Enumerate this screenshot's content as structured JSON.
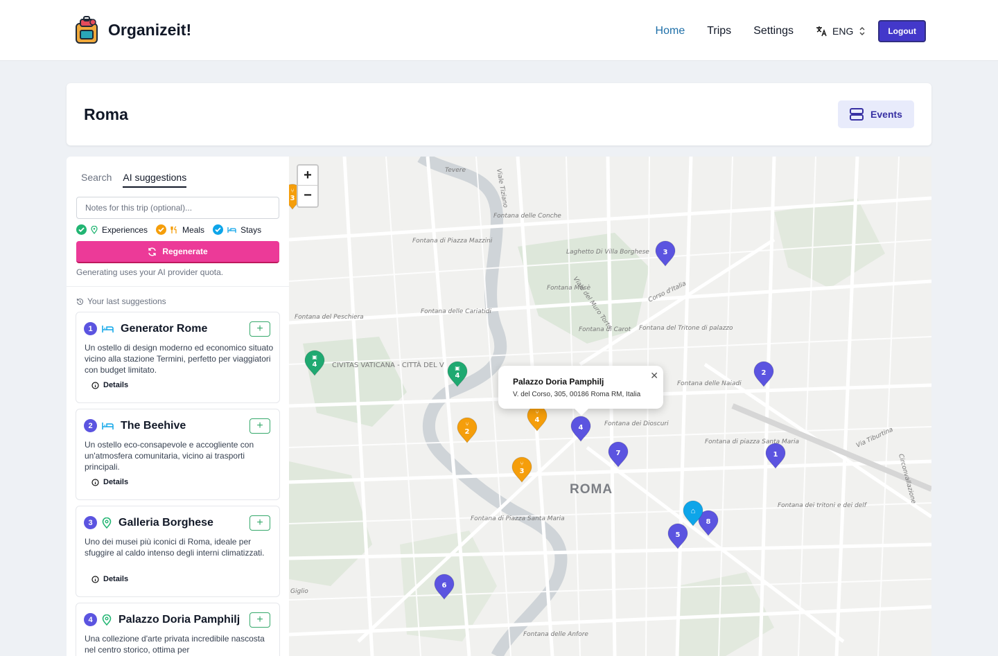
{
  "header": {
    "brand": "Organizeit!",
    "nav": [
      "Home",
      "Trips",
      "Settings"
    ],
    "language": "ENG",
    "logout": "Logout"
  },
  "trip": {
    "title": "Roma",
    "events_button": "Events"
  },
  "sidebar": {
    "tabs": [
      "Search",
      "AI suggestions"
    ],
    "active_tab": "AI suggestions",
    "notes_placeholder": "Notes for this trip (optional)...",
    "filters": [
      {
        "label": "Experiences",
        "checked": true,
        "color": "#22b573"
      },
      {
        "label": "Meals",
        "checked": true,
        "color": "#f59e0b"
      },
      {
        "label": "Stays",
        "checked": true,
        "color": "#0ea5e9"
      }
    ],
    "regenerate": "Regenerate",
    "quota_note": "Generating uses your AI provider quota.",
    "last_suggestions": "Your last suggestions",
    "details_label": "Details",
    "suggestions": [
      {
        "num": "1",
        "type": "stay",
        "title": "Generator Rome",
        "desc": "Un ostello di design moderno ed economico situato vicino alla stazione Termini, perfetto per viaggiatori con budget limitato."
      },
      {
        "num": "2",
        "type": "stay",
        "title": "The Beehive",
        "desc": "Un ostello eco-consapevole e accogliente con un'atmosfera comunitaria, vicino ai trasporti principali."
      },
      {
        "num": "3",
        "type": "experience",
        "title": "Galleria Borghese",
        "desc": "Uno dei musei più iconici di Roma, ideale per sfuggire al caldo intenso degli interni climatizzati."
      },
      {
        "num": "4",
        "type": "experience",
        "title": "Palazzo Doria Pamphilj",
        "desc": "Una collezione d'arte privata incredibile nascosta nel centro storico, ottima per"
      }
    ]
  },
  "map": {
    "city_label": "ROMA",
    "popup": {
      "title": "Palazzo Doria Pamphilj",
      "address": "V. del Corso, 305, 00186 Roma RM, Italia"
    },
    "labels": [
      {
        "text": "Tevere"
      },
      {
        "text": "Viale Tiziano"
      },
      {
        "text": "Fontana delle Conche"
      },
      {
        "text": "Fontana di Piazza Mazzini"
      },
      {
        "text": "Laghetto Di Villa Borghese"
      },
      {
        "text": "Fontana Mosè"
      },
      {
        "text": "Viale del Muro Torto"
      },
      {
        "text": "Corso d'Italia"
      },
      {
        "text": "Fontana del Peschiera"
      },
      {
        "text": "Fontana delle Cariatidi"
      },
      {
        "text": "Fontana di Carot"
      },
      {
        "text": "Fontana del Tritone di palazzo Margherita"
      },
      {
        "text": "CIVITAS VATICANA - CITTÀ DEL VATICANO"
      },
      {
        "text": "Fontana delle Naiadi"
      },
      {
        "text": "Fontana dei Dioscuri"
      },
      {
        "text": "Fontana di piazza Santa Maria Maggiore"
      },
      {
        "text": "Via Tiburtina"
      },
      {
        "text": "Fontana di Piazza Santa Maria in Trastevere"
      },
      {
        "text": "Fontana dei tritoni e dei delfini"
      },
      {
        "text": "Fontana delle Anfore"
      },
      {
        "text": "Giglio"
      },
      {
        "text": "Circonvallazione"
      }
    ],
    "pins": [
      {
        "num": "3",
        "kind": "experience",
        "color": "#5b54e0"
      },
      {
        "num": "2",
        "kind": "experience",
        "color": "#5b54e0"
      },
      {
        "num": "1",
        "kind": "experience",
        "color": "#5b54e0"
      },
      {
        "num": "4",
        "kind": "experience",
        "color": "#5b54e0"
      },
      {
        "num": "7",
        "kind": "experience",
        "color": "#5b54e0"
      },
      {
        "num": "5",
        "kind": "experience",
        "color": "#5b54e0"
      },
      {
        "num": "8",
        "kind": "experience",
        "color": "#5b54e0"
      },
      {
        "num": "6",
        "kind": "experience",
        "color": "#5b54e0"
      },
      {
        "num": "4",
        "kind": "ticket",
        "color": "#1fa971"
      },
      {
        "num": "4",
        "kind": "ticket",
        "color": "#1fa971"
      },
      {
        "num": "2",
        "kind": "meal",
        "color": "#f59e0b"
      },
      {
        "num": "3",
        "kind": "meal",
        "color": "#f59e0b"
      },
      {
        "num": "4",
        "kind": "meal",
        "color": "#f59e0b"
      },
      {
        "num": "3",
        "kind": "meal",
        "color": "#f59e0b"
      },
      {
        "num": "",
        "kind": "stay",
        "color": "#0ea5e9"
      }
    ]
  }
}
